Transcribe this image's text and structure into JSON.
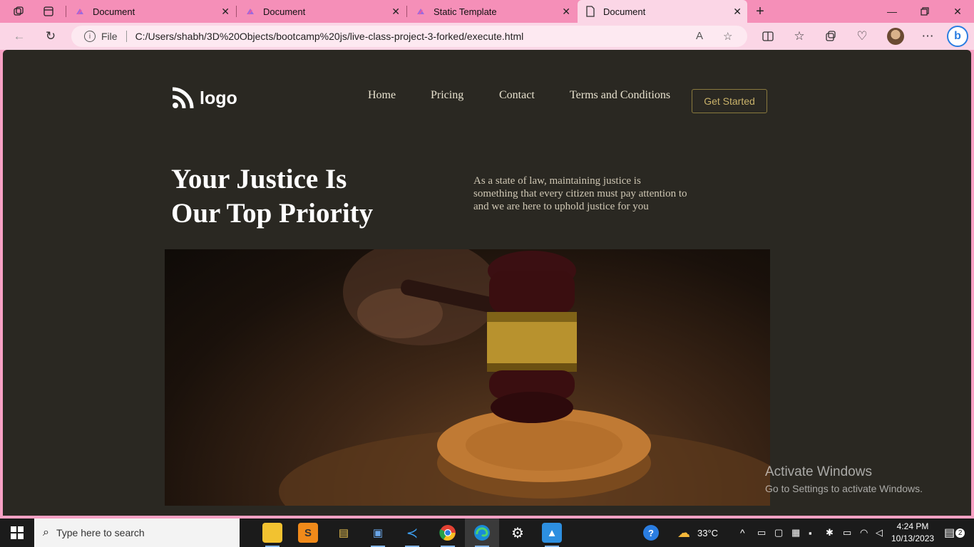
{
  "browser": {
    "tabs": [
      {
        "title": "Document"
      },
      {
        "title": "Document"
      },
      {
        "title": "Static Template"
      },
      {
        "title": "Document"
      }
    ],
    "url_prefix": "File",
    "url": "C:/Users/shabh/3D%20Objects/bootcamp%20js/live-class-project-3-forked/execute.html"
  },
  "site": {
    "logo_text": "logo",
    "nav": [
      "Home",
      "Pricing",
      "Contact",
      "Terms and Conditions"
    ],
    "cta": "Get Started",
    "hero_title_line1": "Your Justice Is",
    "hero_title_line2": "Our Top Priority",
    "hero_desc": "As a state of law, maintaining justice is something that every citizen must pay attention to and we are here to uphold justice for you"
  },
  "watermark": {
    "line1": "Activate Windows",
    "line2": "Go to Settings to activate Windows."
  },
  "taskbar": {
    "search_placeholder": "Type here to search",
    "weather": "33°C",
    "time": "4:24 PM",
    "date": "10/13/2023",
    "notification_count": "2"
  }
}
